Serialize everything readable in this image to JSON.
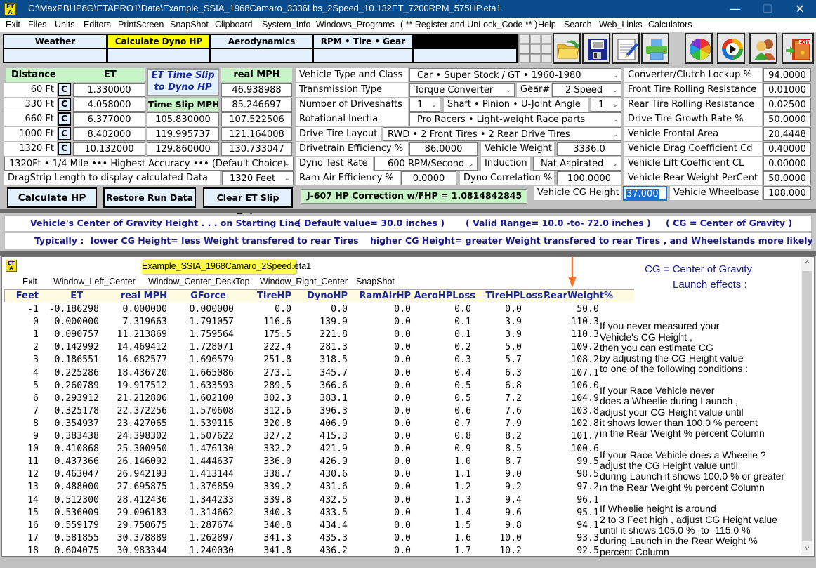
{
  "window": {
    "app_icon": "ET/A",
    "title": "C:\\MaxPBHP8G\\ETAPRO1\\Data\\Example_SSIA_1968Camaro_3336Lbs_2Speed_10.132ET_7200RPM_575HP.eta1",
    "minimize": "—",
    "maximize": "☐",
    "close": "✕"
  },
  "menu": [
    "Exit",
    "Files",
    "Units",
    "Editors",
    "PrintScreen",
    "SnapShot",
    "Clipboard",
    "System_Info",
    "Windows_Programs",
    "( ** Register and UnLock_Code ** )",
    "Help",
    "Search",
    "Web_Links",
    "Calculators"
  ],
  "tabs": [
    {
      "label": "Weather",
      "active": false
    },
    {
      "label": "Calculate Dyno HP",
      "active": true
    },
    {
      "label": "Aerodynamics",
      "active": false
    },
    {
      "label": "RPM  •  Tire  •  Gear",
      "active": false
    },
    {
      "label": "",
      "active": false
    }
  ],
  "toolbar": [
    {
      "icon": "open-folder-icon"
    },
    {
      "icon": "save-disk-icon"
    },
    {
      "icon": "notepad-edit-icon"
    },
    {
      "icon": "printer-icon"
    },
    {
      "icon": "color-wheel-icon"
    },
    {
      "icon": "media-play-icon"
    },
    {
      "icon": "users-icon"
    },
    {
      "icon": "exit-door-icon",
      "text": "EXIT"
    }
  ],
  "et_slip": {
    "headers": {
      "distance": "Distance",
      "et": "ET",
      "real_mph": "real  MPH",
      "time_slip_mph": "Time Slip MPH"
    },
    "et_title_line1": "ET Time Slip",
    "et_title_line2": "to Dyno HP",
    "c_label": "C",
    "rows": [
      {
        "distance": "60 Ft",
        "et": "1.330000",
        "slip_mph": "",
        "real_mph": "46.938988"
      },
      {
        "distance": "330 Ft",
        "et": "4.058000",
        "slip_mph": "",
        "real_mph": "85.246697"
      },
      {
        "distance": "660 Ft",
        "et": "6.377000",
        "slip_mph": "105.830000",
        "real_mph": "107.522506"
      },
      {
        "distance": "1000 Ft",
        "et": "8.402000",
        "slip_mph": "119.995737",
        "real_mph": "121.164008"
      },
      {
        "distance": "1320 Ft",
        "et": "10.132000",
        "slip_mph": "129.860000",
        "real_mph": "130.733047"
      }
    ],
    "accuracy_select": "1320Ft • 1/4 Mile ••• Highest Accuracy ••• (Default Choice)",
    "dragstrip_label": "DragStrip Length to display calculated Data",
    "dragstrip_select": "1320 Feet",
    "buttons": {
      "calculate": "Calculate  HP",
      "restore": "Restore Run Data",
      "clear": "Clear ET Slip Data"
    },
    "j607": "J-607 HP Correction w/FHP = 1.0814842845"
  },
  "vehicle": {
    "type_label": "Vehicle Type and Class",
    "type_value": "Car  •  Super Stock / GT  •  1960-1980",
    "trans_label": "Transmission Type",
    "trans_value": "Torque Converter",
    "gear_label": "Gear#",
    "gear_value": "2  Speed",
    "driveshafts_label": "Number of Driveshafts",
    "driveshafts_value": "1",
    "angle_label": "Shaft • Pinion • U-Joint Angle",
    "angle_value": "1",
    "inertia_label": "Rotational Inertia",
    "inertia_value": "Pro Racers  •  Light-weight Race parts",
    "layout_label": "Drive Tire Layout",
    "layout_value": "RWD • 2  Front Tires  •  2  Rear Drive Tires",
    "efficiency_label": "Drivetrain Efficiency %",
    "efficiency_value": "86.0000",
    "weight_label": "Vehicle Weight",
    "weight_value": "3336.0",
    "dyno_rate_label": "Dyno Test Rate",
    "dyno_rate_value": "600 RPM/Second",
    "induction_label": "Induction",
    "induction_value": "Nat-Aspirated",
    "ramair_label": "Ram-Air Efficiency %",
    "ramair_value": "0.0000",
    "correlation_label": "Dyno Correlation %",
    "correlation_value": "100.0000",
    "cg_label": "Vehicle CG Height",
    "cg_value": "37.000"
  },
  "params": [
    {
      "label": "Converter/Clutch Lockup %",
      "value": "94.0000"
    },
    {
      "label": "Front Tire Rolling Resistance",
      "value": "0.01000"
    },
    {
      "label": "Rear Tire Rolling Resistance",
      "value": "0.02500"
    },
    {
      "label": "Drive Tire Growth Rate %",
      "value": "50.0000"
    },
    {
      "label": "Vehicle Frontal Area",
      "value": "20.4448"
    },
    {
      "label": "Vehicle Drag Coefficient   Cd",
      "value": "0.40000"
    },
    {
      "label": "Vehicle Lift Coefficient      CL",
      "value": "0.00000"
    },
    {
      "label": "Vehicle Rear Weight PerCent",
      "value": "50.0000"
    },
    {
      "label": "Vehicle Wheelbase",
      "value": "108.000"
    }
  ],
  "info": {
    "line1_a": "Vehicle's Center of Gravity Height . . . on Starting Line",
    "line1_b": "( Default value= 30.0 inches )",
    "line1_c": "( Valid Range=  10.0  -to-  72.0 inches )",
    "line1_d": "( CG = Center of Gravity )",
    "line2_a": "Typically :",
    "line2_b": "lower CG Height= less Weight transfered to rear Tires",
    "line2_c": "higher CG Height= greater Weight transfered to rear Tires , and Wheelstands more likely"
  },
  "results": {
    "tooltip": "Example_SSIA_1968Camaro_2Speed.eta1",
    "menu": [
      "Exit",
      "Window_Left_Center",
      "Window_Center_DeskTop",
      "Window_Right_Center",
      "SnapShot"
    ],
    "columns": [
      "Feet",
      "ET",
      "real MPH",
      "GForce",
      "TireHP",
      "DynoHP",
      "RamAirHP",
      "AeroHPLoss",
      "TireHPLoss",
      "RearWeight%"
    ],
    "rows": [
      [
        "-1",
        "-0.186298",
        "0.000000",
        "0.000000",
        "0.0",
        "0.0",
        "0.0",
        "0.0",
        "0.0",
        "50.0"
      ],
      [
        "0",
        "0.000000",
        "7.319663",
        "1.791057",
        "116.6",
        "139.9",
        "0.0",
        "0.1",
        "3.9",
        "110.3"
      ],
      [
        "1",
        "0.090757",
        "11.213869",
        "1.759564",
        "175.5",
        "221.8",
        "0.0",
        "0.1",
        "3.9",
        "110.3"
      ],
      [
        "2",
        "0.142992",
        "14.469412",
        "1.728071",
        "222.4",
        "281.3",
        "0.0",
        "0.2",
        "5.0",
        "109.2"
      ],
      [
        "3",
        "0.186551",
        "16.682577",
        "1.696579",
        "251.8",
        "318.5",
        "0.0",
        "0.3",
        "5.7",
        "108.2"
      ],
      [
        "4",
        "0.225286",
        "18.436720",
        "1.665086",
        "273.1",
        "345.7",
        "0.0",
        "0.4",
        "6.3",
        "107.1"
      ],
      [
        "5",
        "0.260789",
        "19.917512",
        "1.633593",
        "289.5",
        "366.6",
        "0.0",
        "0.5",
        "6.8",
        "106.0"
      ],
      [
        "6",
        "0.293912",
        "21.212806",
        "1.602100",
        "302.3",
        "383.1",
        "0.0",
        "0.5",
        "7.2",
        "104.9"
      ],
      [
        "7",
        "0.325178",
        "22.372256",
        "1.570608",
        "312.6",
        "396.3",
        "0.0",
        "0.6",
        "7.6",
        "103.8"
      ],
      [
        "8",
        "0.354937",
        "23.427065",
        "1.539115",
        "320.8",
        "406.9",
        "0.0",
        "0.7",
        "7.9",
        "102.8"
      ],
      [
        "9",
        "0.383438",
        "24.398302",
        "1.507622",
        "327.2",
        "415.3",
        "0.0",
        "0.8",
        "8.2",
        "101.7"
      ],
      [
        "10",
        "0.410868",
        "25.300950",
        "1.476130",
        "332.2",
        "421.9",
        "0.0",
        "0.9",
        "8.5",
        "100.6"
      ],
      [
        "11",
        "0.437366",
        "26.146092",
        "1.444637",
        "336.0",
        "426.9",
        "0.0",
        "1.0",
        "8.7",
        "99.5"
      ],
      [
        "12",
        "0.463047",
        "26.942193",
        "1.413144",
        "338.7",
        "430.6",
        "0.0",
        "1.1",
        "9.0",
        "98.5"
      ],
      [
        "13",
        "0.488000",
        "27.695875",
        "1.376859",
        "339.2",
        "431.6",
        "0.0",
        "1.2",
        "9.2",
        "97.2"
      ],
      [
        "14",
        "0.512300",
        "28.412436",
        "1.344233",
        "339.8",
        "432.5",
        "0.0",
        "1.3",
        "9.4",
        "96.1"
      ],
      [
        "15",
        "0.536009",
        "29.096183",
        "1.314662",
        "340.3",
        "433.5",
        "0.0",
        "1.4",
        "9.6",
        "95.1"
      ],
      [
        "16",
        "0.559179",
        "29.750675",
        "1.287674",
        "340.8",
        "434.4",
        "0.0",
        "1.5",
        "9.8",
        "94.1"
      ],
      [
        "17",
        "0.581855",
        "30.378889",
        "1.262897",
        "341.3",
        "435.3",
        "0.0",
        "1.6",
        "10.0",
        "93.3"
      ],
      [
        "18",
        "0.604075",
        "30.983344",
        "1.240030",
        "341.8",
        "436.2",
        "0.0",
        "1.7",
        "10.2",
        "92.5"
      ]
    ],
    "cg_title_line1": "CG = Center of Gravity",
    "cg_title_line2": "Launch effects :",
    "help_paragraphs": [
      [
        "If you never measured your",
        "Vehicle's CG Height ,",
        "then you can estimate CG",
        "by adjusting the CG Height value",
        "to one of the following conditions :"
      ],
      [
        "If your Race Vehicle never",
        "does a Wheelie during Launch ,",
        "adjust your CG Height value until",
        "it shows lower than 100.0 % percent",
        "in the Rear Weight % percent Column"
      ],
      [
        "If your Race Vehicle does a Wheelie ?",
        "adjust the CG Height value until",
        "during Launch it shows 100.0 % or greater",
        "in the Rear Weight % percent Column"
      ],
      [
        "If Wheelie height is around",
        "2 to 3 Feet high , adjust CG Height value",
        "until it shows 105.0 % -to- 115.0 %",
        "during Launch in the Rear Weight %",
        "percent Column"
      ]
    ],
    "scroll_up": "^",
    "scroll_down": "v"
  },
  "colors": {
    "titlebar": "#0b4c8c",
    "active_tab": "#ffff00",
    "header_green": "#c7f5c7",
    "info_text": "#1a1a8a",
    "arrow": "#f07a30"
  }
}
